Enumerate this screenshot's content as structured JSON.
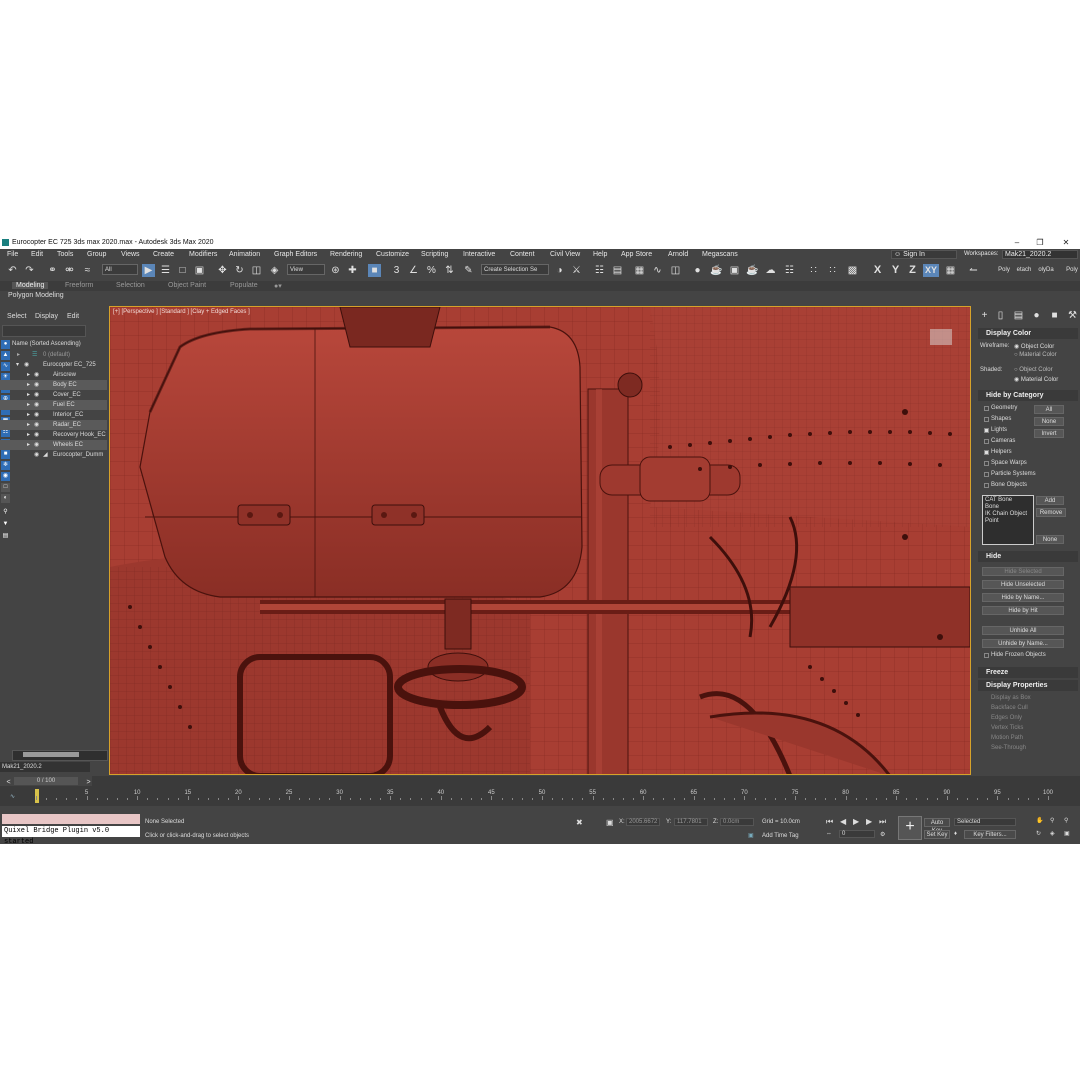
{
  "window": {
    "title": "Eurocopter EC 725 3ds max 2020.max - Autodesk 3ds Max 2020",
    "minimize": "–",
    "maximize": "❐",
    "close": "✕"
  },
  "menu": {
    "items": [
      "File",
      "Edit",
      "Tools",
      "Group",
      "Views",
      "Create",
      "Modifiers",
      "Animation",
      "Graph Editors",
      "Rendering",
      "Customize",
      "Scripting",
      "Interactive",
      "Content",
      "Civil View",
      "Help",
      "App Store",
      "Arnold",
      "Megascans"
    ],
    "sign_in": "Sign In",
    "workspaces_label": "Workspaces:",
    "workspace_value": "Mak21_2020.2"
  },
  "toolbar": {
    "filter_value": "All",
    "view_value": "View",
    "selection_set_placeholder": "Create Selection Se",
    "axis_x": "X",
    "axis_y": "Y",
    "axis_z": "Z",
    "axis_xy": "XY",
    "right_labels": [
      "Poly",
      "etach",
      "olyDa",
      "Poly"
    ]
  },
  "ribbon": {
    "tabs": [
      "Modeling",
      "Freeform",
      "Selection",
      "Object Paint",
      "Populate"
    ],
    "sub_label": "Polygon Modeling"
  },
  "scene_explorer": {
    "tabs": [
      "Select",
      "Display",
      "Edit"
    ],
    "header": "Name (Sorted Ascending)",
    "rows": [
      {
        "label": "0 (default)",
        "indent": 0
      },
      {
        "label": "Eurocopter EC_725",
        "indent": 1
      },
      {
        "label": "Airscrew",
        "indent": 2
      },
      {
        "label": "Body EC",
        "indent": 2
      },
      {
        "label": "Cover_EC",
        "indent": 2
      },
      {
        "label": "Fuel EC",
        "indent": 2
      },
      {
        "label": "Interior_EC",
        "indent": 2
      },
      {
        "label": "Radar_EC",
        "indent": 2
      },
      {
        "label": "Recovery Hook_EC",
        "indent": 2
      },
      {
        "label": "Wheels EC",
        "indent": 2
      },
      {
        "label": "Eurocopter_Dumm",
        "indent": 2
      }
    ],
    "layer_value": "Mak21_2020.2"
  },
  "viewport": {
    "label": "[+] [Perspective ] [Standard ] [Clay + Edged Faces ]",
    "bg_color": "#a33c31",
    "border_color": "#d6a22a"
  },
  "command_panel": {
    "display_color": {
      "title": "Display Color",
      "wireframe_label": "Wireframe:",
      "shaded_label": "Shaded:",
      "object_color": "Object Color",
      "material_color": "Material Color"
    },
    "hide_by_category": {
      "title": "Hide by Category",
      "items": [
        "Geometry",
        "Shapes",
        "Lights",
        "Cameras",
        "Helpers",
        "Space Warps",
        "Particle Systems",
        "Bone Objects"
      ],
      "checked": [
        false,
        false,
        true,
        false,
        true,
        false,
        false,
        false
      ],
      "buttons": [
        "All",
        "None",
        "Invert"
      ],
      "list": [
        "CAT Bone",
        "Bone",
        "IK Chain Object",
        "Point"
      ],
      "add": "Add",
      "remove": "Remove",
      "none": "None"
    },
    "hide": {
      "title": "Hide",
      "buttons": [
        "Hide Selected",
        "Hide Unselected",
        "Hide by Name...",
        "Hide by Hit",
        "Unhide All",
        "Unhide by Name..."
      ],
      "hide_frozen": "Hide Frozen Objects"
    },
    "freeze": {
      "title": "Freeze"
    },
    "display_properties": {
      "title": "Display Properties",
      "items": [
        "Display as Box",
        "Backface Cull",
        "Edges Only",
        "Vertex Ticks",
        "Motion Path",
        "See-Through"
      ]
    }
  },
  "timeline": {
    "frame_counter": "0 / 100",
    "ticks": [
      0,
      5,
      10,
      15,
      20,
      25,
      30,
      35,
      40,
      45,
      50,
      55,
      60,
      65,
      70,
      75,
      80,
      85,
      90,
      95,
      100
    ]
  },
  "status_bar": {
    "maxscript_output": "Quixel Bridge Plugin v5.0 started",
    "selection": "None Selected",
    "prompt": "Click or click-and-drag to select objects",
    "x_label": "X:",
    "x_value": "2005.6672",
    "y_label": "Y:",
    "y_value": "117.7801",
    "z_label": "Z:",
    "z_value": "0.0cm",
    "grid": "Grid = 10.0cm",
    "add_time_tag": "Add Time Tag",
    "auto_key": "Auto Key",
    "set_key": "Set Key",
    "selected_value": "Selected",
    "key_filters": "Key Filters...",
    "frame_value": "0"
  }
}
